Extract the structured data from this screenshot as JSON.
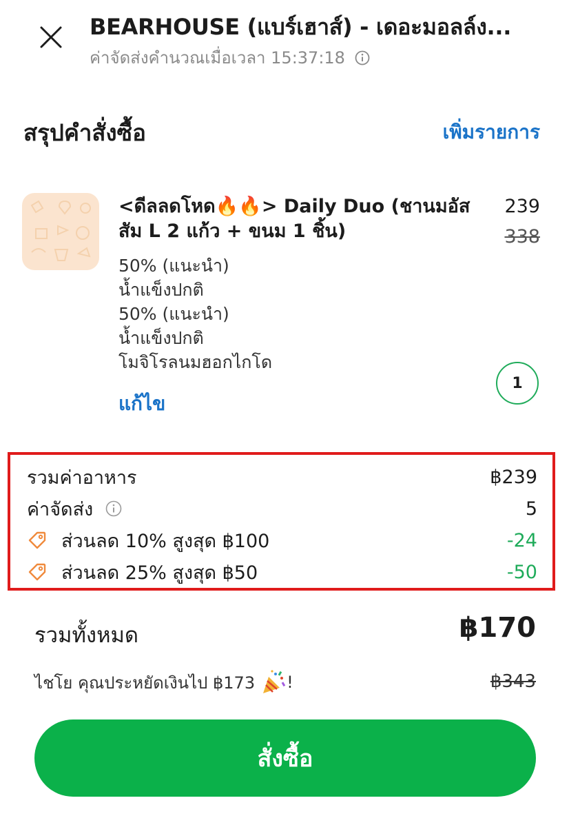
{
  "header": {
    "store_name": "BEARHOUSE (แบร์เฮาส์) - เดอะมอลล์ง...",
    "delivery_calc_text": "ค่าจัดส่งคำนวณเมื่อเวลา 15:37:18"
  },
  "summary": {
    "title": "สรุปคำสั่งซื้อ",
    "add_items_label": "เพิ่มรายการ"
  },
  "item": {
    "title": "<ดีลลดโหด🔥🔥> Daily Duo (ชานมอัสสัม L 2 แก้ว + ขนม 1 ชิ้น)",
    "price": "239",
    "original_price": "338",
    "options": [
      "50% (แนะนำ)",
      "น้ำแข็งปกติ",
      "50% (แนะนำ)",
      "น้ำแข็งปกติ",
      "โมจิโรลนมฮอกไกโด"
    ],
    "edit_label": "แก้ไข",
    "quantity": "1"
  },
  "breakdown": {
    "food_total_label": "รวมค่าอาหาร",
    "food_total_value": "฿239",
    "delivery_label": "ค่าจัดส่ง",
    "delivery_value": "5",
    "discounts": [
      {
        "label": "ส่วนลด 10% สูงสุด ฿100",
        "value": "-24"
      },
      {
        "label": "ส่วนลด 25% สูงสุด ฿50",
        "value": "-50"
      }
    ]
  },
  "total": {
    "label": "รวมทั้งหมด",
    "value": "฿170",
    "savings_text": "ไชโย คุณประหยัดเงินไป  ฿173",
    "savings_suffix": "!",
    "original_total": "฿343"
  },
  "order_button_label": "สั่งซื้อ",
  "colors": {
    "accent_blue": "#1a73c8",
    "discount_green": "#1fab5a",
    "button_green": "#0bb14a",
    "highlight_red": "#e01b1b",
    "discount_tag_orange": "#f08a3c"
  },
  "icons": {
    "close": "close-icon",
    "info": "info-icon",
    "discount": "tag-icon",
    "celebration": "party-popper-icon",
    "item_image": "food-pattern-image"
  }
}
